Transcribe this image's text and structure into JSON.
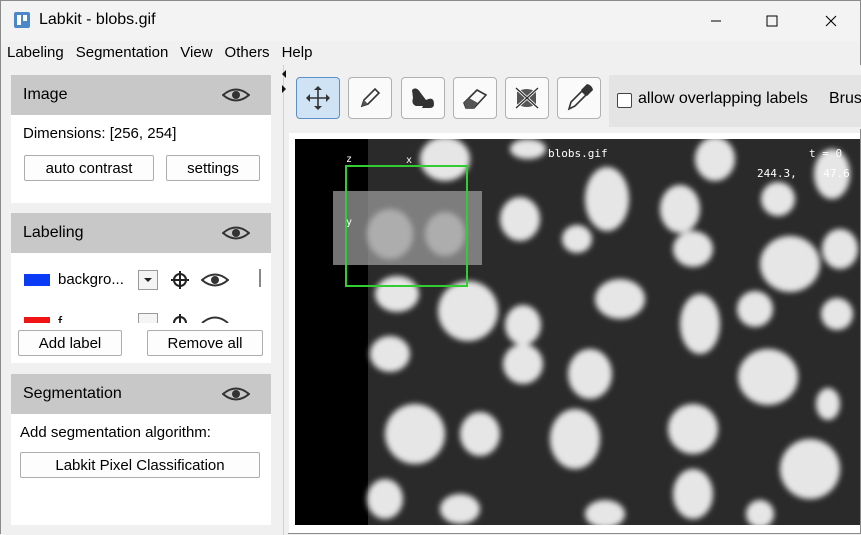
{
  "window": {
    "title": "Labkit - blobs.gif",
    "minimize_glyph": "—",
    "maximize_glyph": "☐",
    "close_glyph": "✕"
  },
  "menu": [
    "Labeling",
    "Segmentation",
    "View",
    "Others",
    "Help"
  ],
  "image_panel": {
    "title": "Image",
    "dimensions": "Dimensions: [256, 254]",
    "auto_contrast": "auto contrast",
    "settings": "settings"
  },
  "labeling_panel": {
    "title": "Labeling",
    "labels": [
      {
        "name": "backgro...",
        "color": "#0a3cf5"
      },
      {
        "name": "f",
        "color": "#f01414"
      }
    ],
    "add_label": "Add label",
    "remove_all": "Remove all"
  },
  "segmentation_panel": {
    "title": "Segmentation",
    "prompt": "Add segmentation algorithm:",
    "algorithm_button": "Labkit Pixel Classification"
  },
  "toolbar": {
    "tools": [
      "move-tool-icon",
      "pencil-icon",
      "flood-fill-icon",
      "eraser-icon",
      "flood-erase-icon",
      "eyedropper-icon"
    ],
    "active_tool": "move-tool-icon",
    "allow_overlapping_labels": "allow overlapping labels",
    "allow_overlapping_checked": false,
    "brush_label": "Brus"
  },
  "viewer": {
    "image_name": "blobs.gif",
    "time": "t = 0",
    "coords": "244.3,    47.6",
    "axis_z": "z",
    "axis_x": "x",
    "axis_y": "y",
    "navigator_box_color": "#33cc33"
  }
}
